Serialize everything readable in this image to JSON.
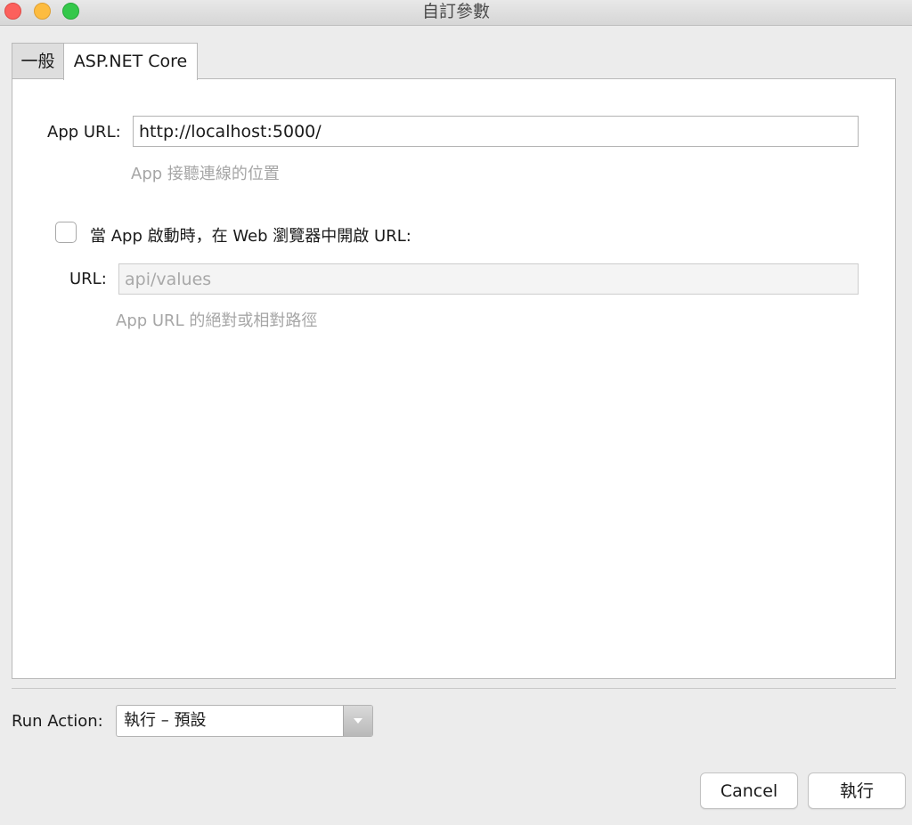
{
  "window": {
    "title": "自訂參數"
  },
  "tabs": [
    {
      "label": "一般"
    },
    {
      "label": "ASP.NET Core"
    }
  ],
  "app_url": {
    "label": "App URL:",
    "value": "http://localhost:5000/",
    "hint": "App 接聽連線的位置"
  },
  "launch_browser": {
    "checked": false,
    "label": "當 App 啟動時，在 Web 瀏覽器中開啟 URL:"
  },
  "launch_url": {
    "label": "URL:",
    "placeholder": "api/values",
    "hint": "App URL 的絕對或相對路徑"
  },
  "run_action": {
    "label": "Run Action:",
    "selected": "執行 – 預設"
  },
  "buttons": {
    "cancel": "Cancel",
    "run": "執行"
  }
}
